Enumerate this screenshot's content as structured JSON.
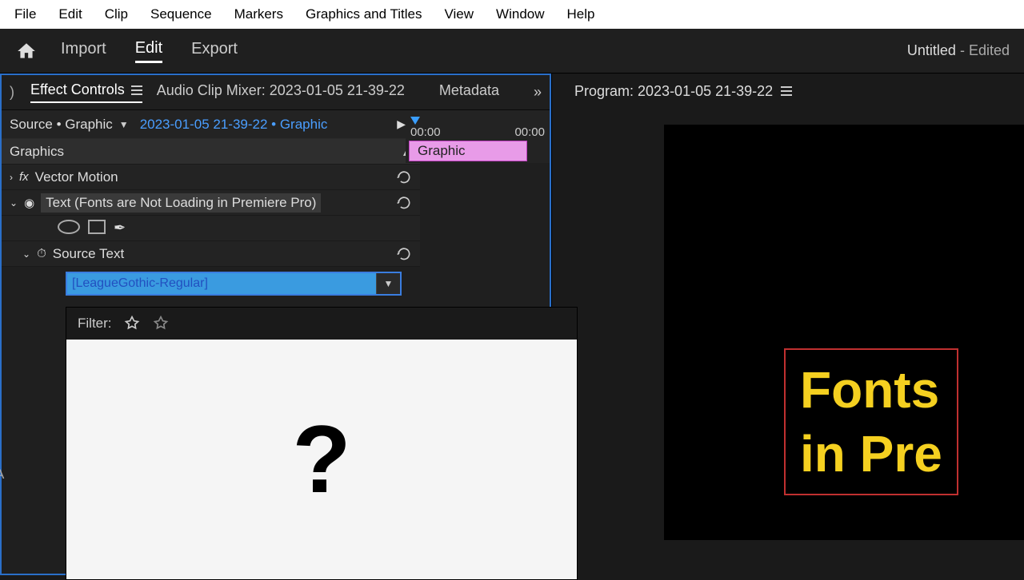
{
  "menubar": [
    "File",
    "Edit",
    "Clip",
    "Sequence",
    "Markers",
    "Graphics and Titles",
    "View",
    "Window",
    "Help"
  ],
  "workspace": {
    "tabs": [
      "Import",
      "Edit",
      "Export"
    ],
    "active": 1
  },
  "project": {
    "name": "Untitled",
    "status": "- Edited"
  },
  "panels": {
    "effectControls": "Effect Controls",
    "audioMixer": "Audio Clip Mixer: 2023-01-05 21-39-22",
    "metadata": "Metadata"
  },
  "source": {
    "label": "Source • Graphic",
    "sequence": "2023-01-05 21-39-22 • Graphic"
  },
  "timeline": {
    "t0": "00:00",
    "t1": "00:00",
    "clip": "Graphic"
  },
  "effects": {
    "header": "Graphics",
    "vectorMotion": "Vector Motion",
    "textLayer": "Text (Fonts are Not Loading in Premiere Pro)",
    "sourceText": "Source Text"
  },
  "fontDropdown": {
    "value": "[LeagueGothic-Regular]"
  },
  "fontPopup": {
    "filterLabel": "Filter:",
    "placeholder": "?"
  },
  "program": {
    "label": "Program: 2023-01-05 21-39-22"
  },
  "preview": {
    "line1": "Fonts ",
    "line2": "in Pre"
  },
  "stray": "A"
}
